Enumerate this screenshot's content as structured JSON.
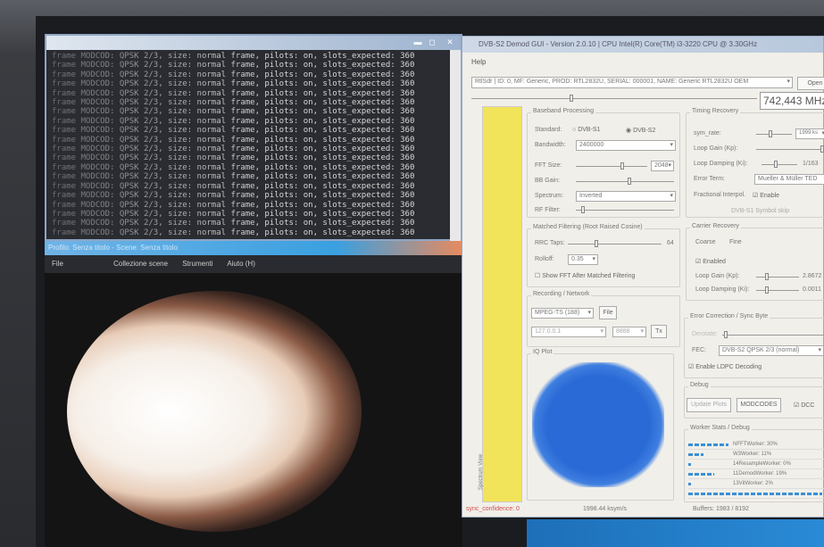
{
  "terminal": {
    "line_text": "frame MODCOD: QPSK 2/3, size: normal frame, pilots: on, slots_expected: 360",
    "line_count": 20,
    "minimize": "▬",
    "maximize": "◻",
    "close": "✕"
  },
  "obs": {
    "title": "Profilo: Senza titolo - Scene: Senza titolo",
    "menu": [
      "File",
      "Collezione scene",
      "Strumenti",
      "Aiuto (H)"
    ]
  },
  "dvb": {
    "title": "DVB-S2 Demod GUI - Version 2.0.10 | CPU      Intel(R) Core(TM) i3-3220 CPU @ 3.30GHz",
    "menu_help": "Help",
    "device": "RtlSdr | ID: 0, MF: Generic, PROD: RTL2832U, SERIAL: 000001, NAME: Generic RTL2832U OEM",
    "open_button": "Open Device",
    "frequency": "742,443 MHz",
    "baseband": {
      "title": "Baseband Processing",
      "standard_label": "Standard:",
      "opt1": "DVB-S1",
      "opt2": "DVB-S2",
      "selected": "DVB-S2",
      "bandwidth_label": "Bandwidth:",
      "bandwidth": "2400000",
      "fft_label": "FFT Size:",
      "fft": "2048",
      "bb_gain_label": "BB Gain:",
      "spectrum_label": "Spectrum:",
      "spectrum": "Inverted",
      "rf_filter_label": "RF Filter:"
    },
    "timing": {
      "title": "Timing Recovery",
      "sym_rate_label": "sym_rate:",
      "sym_rate": "1999 ks",
      "loop_gain_label": "Loop Gain (Kp):",
      "loop_damping_label": "Loop Damping (Ki):",
      "loop_damping": "1/163",
      "error_term_label": "Error Term:",
      "error_term": "Mueller & Müller TED",
      "frac_label": "Fractional Interpol.",
      "frac_enable": "Enable",
      "symbol_skip": "DVB-S1 Symbol skip"
    },
    "matched": {
      "title": "Matched Filtering (Root Raised Cosine)",
      "taps_label": "RRC Taps:",
      "taps": "64",
      "rolloff_label": "Rolloff:",
      "rolloff": "0.35",
      "show_fft": "Show FFT After Matched Filtering"
    },
    "recording": {
      "title": "Recording / Network",
      "format": "MPEG-TS (188)",
      "file_button": "File",
      "ip": "127.0.0.1",
      "port": "8888",
      "tx_button": "Tx"
    },
    "iq": {
      "title": "IQ Plot"
    },
    "spectrum_view": "Spectrum View",
    "carrier": {
      "title": "Carrier Recovery",
      "coarse": "Coarse",
      "fine": "Fine",
      "enabled": "Enabled",
      "loop_gain_label": "Loop Gain (Kp):",
      "loop_gain": "2.8672",
      "loop_damping_label": "Loop Damping (Ki):",
      "loop_damping": "0.0011"
    },
    "error": {
      "title": "Error Correction / Sync Byte",
      "derotate_label": "Derotate:",
      "fec_label": "FEC:",
      "fec": "DVB-S2 QPSK 2/3 (normal)",
      "ldpc": "Enable LDPC Decoding"
    },
    "debug": {
      "title": "Debug",
      "update_plots": "Update Plots",
      "modcodes": "MODCODES",
      "dcc": "DCC"
    },
    "workers": {
      "title": "Worker Stats / Debug",
      "items": [
        {
          "label": "NFFTWorker: 30%",
          "value": 30
        },
        {
          "label": "W3Worker: 11%",
          "value": 11
        },
        {
          "label": "14ResampleWorker: 0%",
          "value": 1
        },
        {
          "label": "11DemodWorker: 19%",
          "value": 19
        },
        {
          "label": "13VitWorker: 2%",
          "value": 2
        },
        {
          "label": "",
          "value": 100
        }
      ]
    },
    "status": {
      "sync": "sync_confidence: 0",
      "rate": "1998.44 ksym/s",
      "buffers": "Buffers: 1983 / 8192"
    },
    "colors": {
      "accent": "#3a8fd8",
      "yellow": "#f2e45a",
      "error": "#d05050"
    }
  }
}
